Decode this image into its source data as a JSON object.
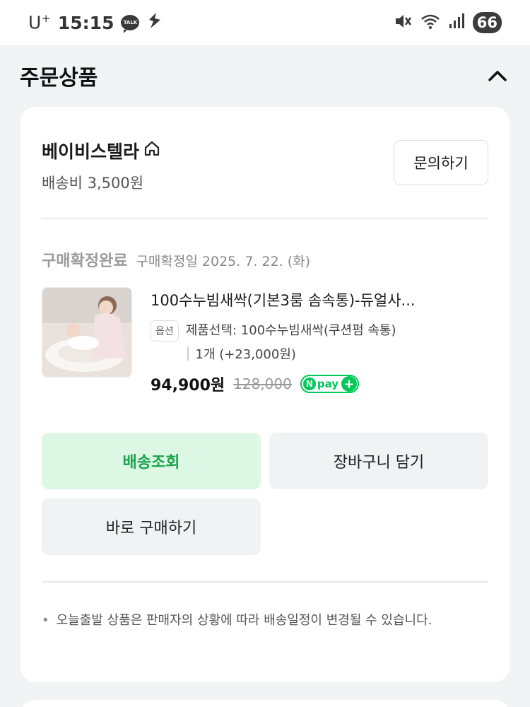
{
  "status_bar": {
    "carrier": "U",
    "carrier_sup": "+",
    "time": "15:15",
    "talk_label": "TALK",
    "battery": "66"
  },
  "section": {
    "title": "주문상품"
  },
  "store": {
    "name": "베이비스텔라",
    "shipping_fee": "배송비 3,500원",
    "inquiry_label": "문의하기"
  },
  "order": {
    "status_label": "구매확정완료",
    "status_date": "구매확정일 2025. 7. 22. (화)"
  },
  "product": {
    "name": "100수누빔새싹(기본3룸 솜속통)-듀얼사...",
    "option_tag": "옵션",
    "option_text": "제품선택: 100수누빔새싹(쿠션펌 속통)",
    "quantity": "1개 (+23,000원)",
    "price": "94,900원",
    "original_price": "128,000",
    "npay_label": "pay"
  },
  "buttons": {
    "track": "배송조회",
    "cart": "장바구니 담기",
    "buy_now": "바로 구매하기"
  },
  "notice": {
    "text": "오늘출발 상품은 판매자의 상황에 따라 배송일정이 변경될 수 있습니다."
  },
  "colors": {
    "accent_green": "#03c75a",
    "track_bg": "#dcf7e4",
    "track_text": "#1aa34a",
    "page_bg": "#f1f3f5"
  }
}
